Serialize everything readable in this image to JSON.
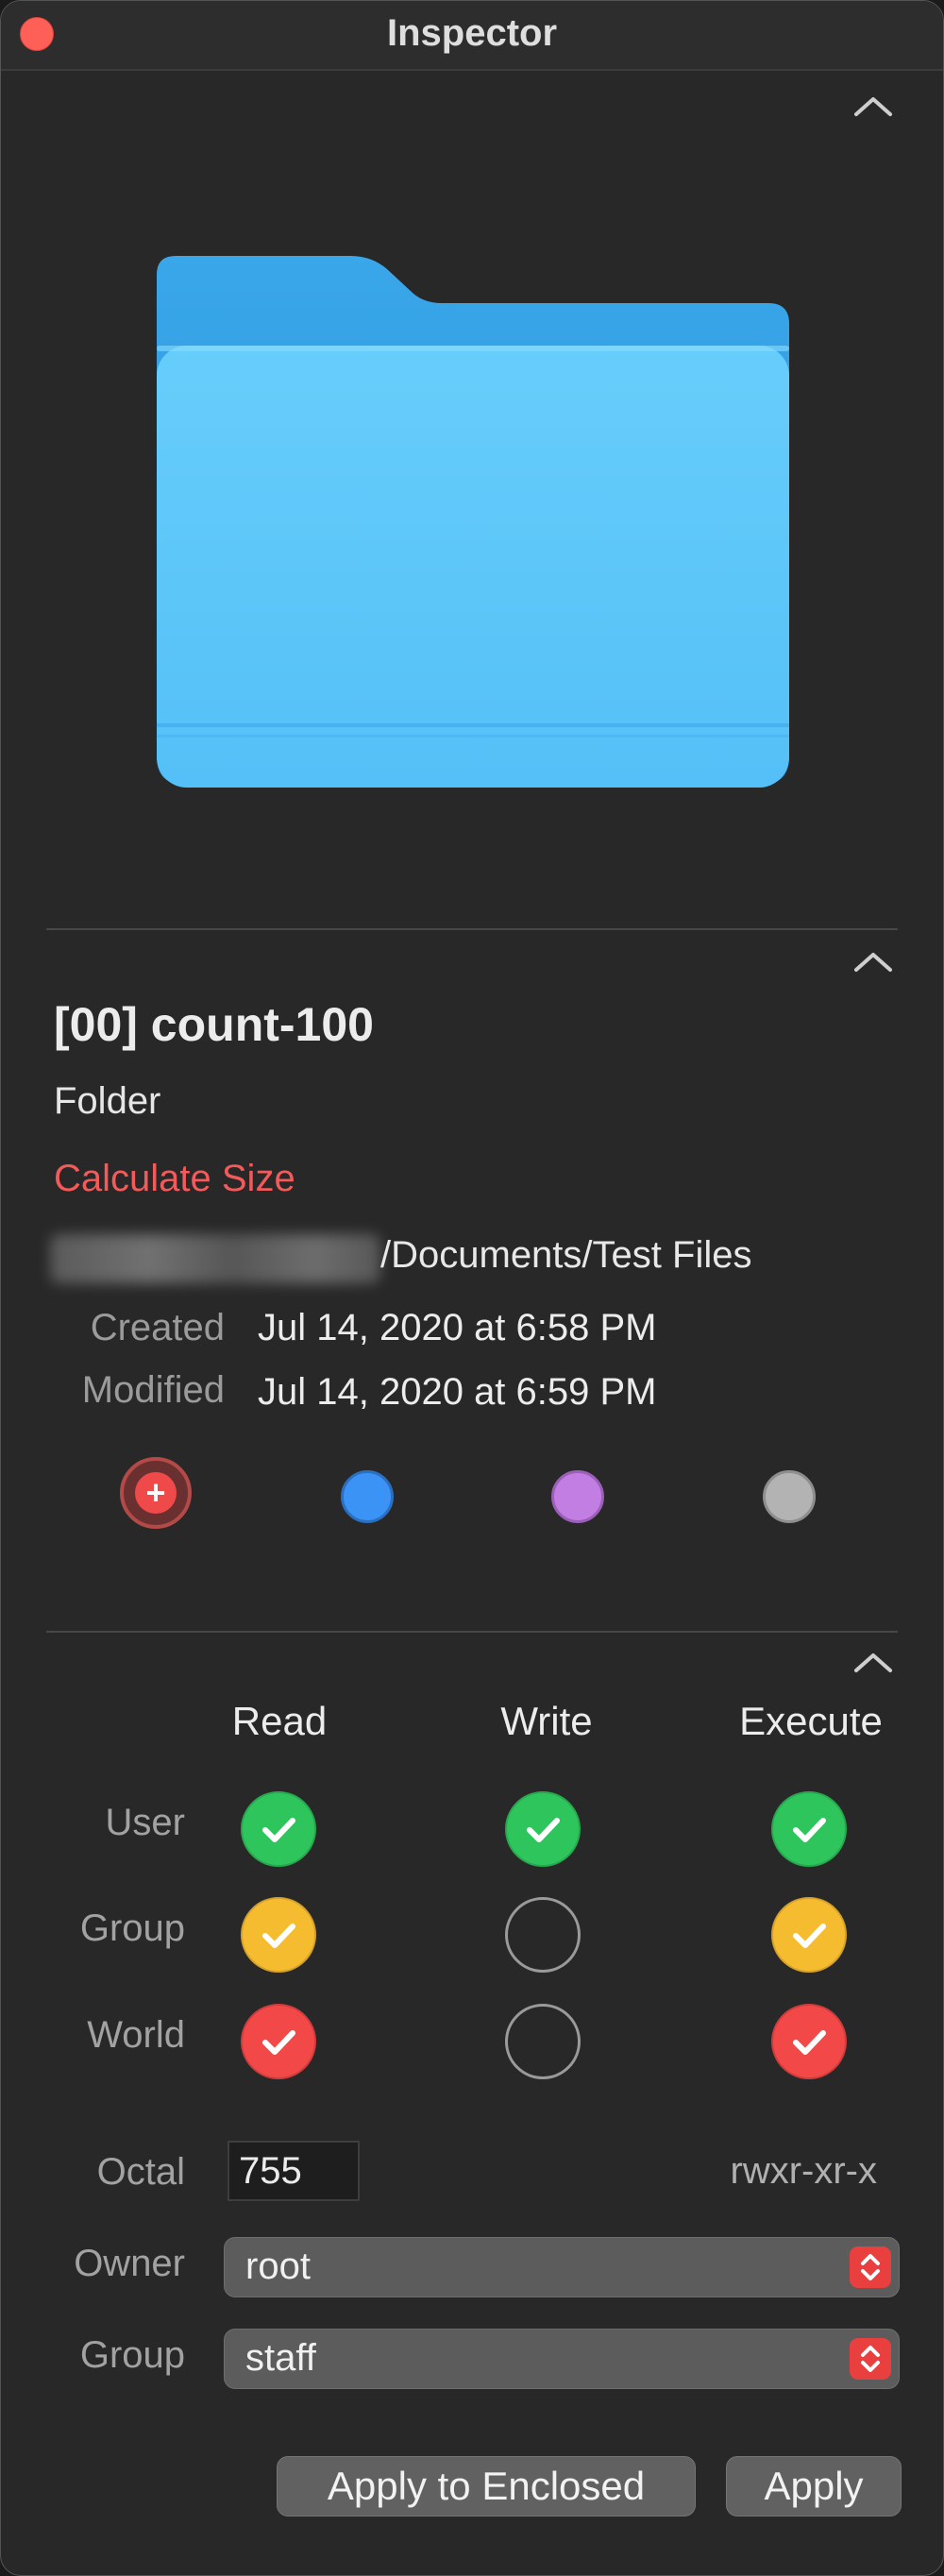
{
  "window": {
    "title": "Inspector"
  },
  "file": {
    "name": "[00] count-100",
    "kind": "Folder",
    "calculate_size_label": "Calculate Size",
    "path_visible": "/Documents/Test Files",
    "created_label": "Created",
    "created_value": "Jul 14, 2020 at 6:58 PM",
    "modified_label": "Modified",
    "modified_value": "Jul 14, 2020 at 6:59 PM"
  },
  "tags": [
    {
      "color": "#f0494a",
      "icon": "plus-icon",
      "selected": true
    },
    {
      "color": "#3c93f6"
    },
    {
      "color": "#c27ee3"
    },
    {
      "color": "#b3b3b3"
    }
  ],
  "permissions": {
    "columns": [
      "Read",
      "Write",
      "Execute"
    ],
    "rows": [
      {
        "label": "User",
        "read": true,
        "write": true,
        "execute": true,
        "color": "#2ec55c"
      },
      {
        "label": "Group",
        "read": true,
        "write": false,
        "execute": true,
        "color": "#f6bc2f"
      },
      {
        "label": "World",
        "read": true,
        "write": false,
        "execute": true,
        "color": "#f24848"
      }
    ],
    "octal_label": "Octal",
    "octal_value": "755",
    "symbolic": "rwxr-xr-x",
    "owner_label": "Owner",
    "owner_value": "root",
    "group_label": "Group",
    "group_value": "staff"
  },
  "buttons": {
    "apply_enclosed": "Apply to Enclosed",
    "apply": "Apply"
  }
}
